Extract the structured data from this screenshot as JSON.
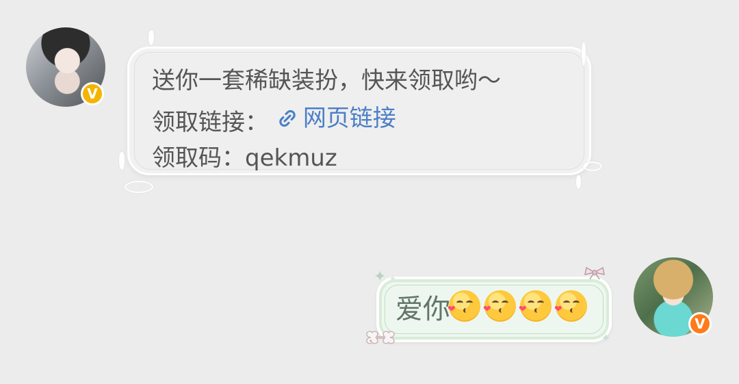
{
  "conversation": {
    "left_message": {
      "line1": "送你一套稀缺装扮，快来领取哟～",
      "line2_prefix": "领取链接：",
      "link_text": "网页链接",
      "line3": "领取码：qekmuz"
    },
    "right_message": {
      "text": "爱你"
    }
  },
  "badges": {
    "left": "V",
    "right": "V"
  },
  "icons": {
    "link": "link-icon",
    "emoji": "kiss-emoji"
  },
  "colors": {
    "background": "#ececec",
    "link": "#4b7fc6",
    "left_text": "#555555",
    "right_text": "#617569",
    "badge_left": "#f4b400",
    "badge_right": "#ff7a1a"
  }
}
